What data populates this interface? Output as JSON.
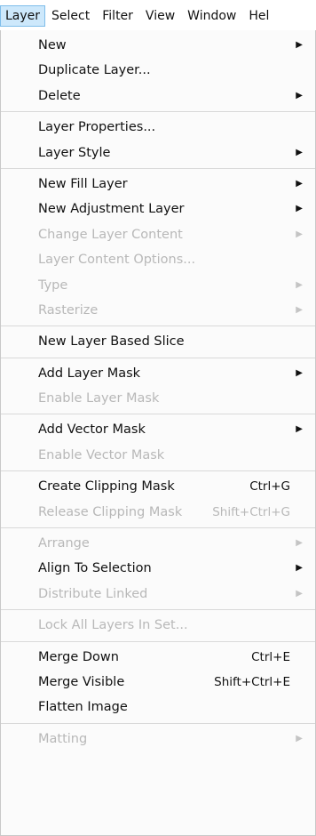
{
  "menubar": {
    "items": [
      "Layer",
      "Select",
      "Filter",
      "View",
      "Window",
      "Hel"
    ]
  },
  "menu": {
    "groups": [
      [
        {
          "label": "New",
          "submenu": true
        },
        {
          "label": "Duplicate Layer..."
        },
        {
          "label": "Delete",
          "submenu": true
        }
      ],
      [
        {
          "label": "Layer Properties..."
        },
        {
          "label": "Layer Style",
          "submenu": true
        }
      ],
      [
        {
          "label": "New Fill Layer",
          "submenu": true
        },
        {
          "label": "New Adjustment Layer",
          "submenu": true
        },
        {
          "label": "Change Layer Content",
          "submenu": true,
          "disabled": true
        },
        {
          "label": "Layer Content Options...",
          "disabled": true
        },
        {
          "label": "Type",
          "submenu": true,
          "disabled": true
        },
        {
          "label": "Rasterize",
          "submenu": true,
          "disabled": true
        }
      ],
      [
        {
          "label": "New Layer Based Slice"
        }
      ],
      [
        {
          "label": "Add Layer Mask",
          "submenu": true
        },
        {
          "label": "Enable Layer Mask",
          "disabled": true
        }
      ],
      [
        {
          "label": "Add Vector Mask",
          "submenu": true
        },
        {
          "label": "Enable Vector Mask",
          "disabled": true
        }
      ],
      [
        {
          "label": "Create Clipping Mask",
          "shortcut": "Ctrl+G"
        },
        {
          "label": "Release Clipping Mask",
          "shortcut": "Shift+Ctrl+G",
          "disabled": true
        }
      ],
      [
        {
          "label": "Arrange",
          "submenu": true,
          "disabled": true
        },
        {
          "label": "Align To Selection",
          "submenu": true
        },
        {
          "label": "Distribute Linked",
          "submenu": true,
          "disabled": true
        }
      ],
      [
        {
          "label": "Lock All Layers In Set...",
          "disabled": true
        }
      ],
      [
        {
          "label": "Merge Down",
          "shortcut": "Ctrl+E"
        },
        {
          "label": "Merge Visible",
          "shortcut": "Shift+Ctrl+E"
        },
        {
          "label": "Flatten Image"
        }
      ],
      [
        {
          "label": "Matting",
          "submenu": true,
          "disabled": true
        }
      ]
    ]
  },
  "icons": {
    "submenu_arrow": "submenu-arrow-icon"
  }
}
